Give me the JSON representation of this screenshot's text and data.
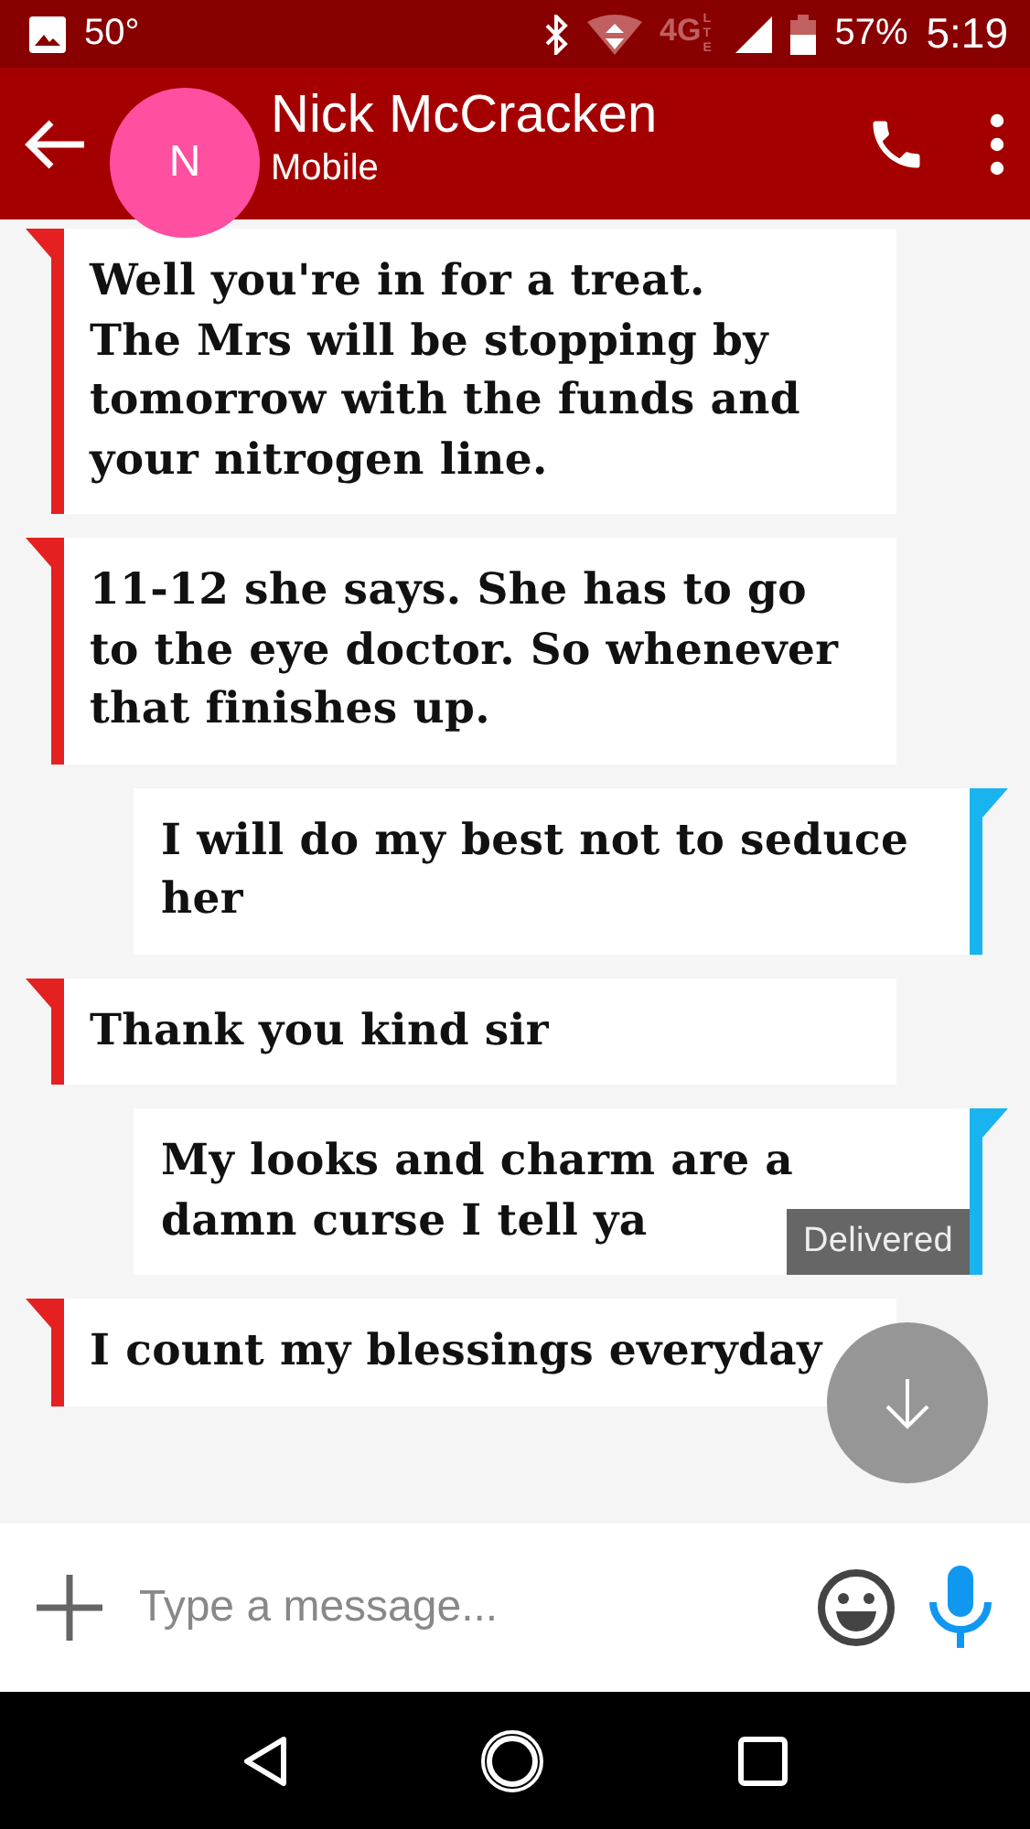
{
  "status_bar": {
    "temperature": "50°",
    "network": "4G",
    "network_sub": "LTE",
    "battery": "57%",
    "time": "5:19"
  },
  "header": {
    "avatar_letter": "N",
    "name": "Nick McCracken",
    "subtitle": "Mobile"
  },
  "messages": [
    {
      "kind": "incoming",
      "text": "Well you're in for a treat.\nThe Mrs will be stopping by tomorrow with the funds and your nitrogen line."
    },
    {
      "kind": "incoming",
      "text": "11-12 she says. She has to go to the eye doctor. So whenever that finishes up."
    },
    {
      "kind": "outgoing",
      "text": "I will do my best not to seduce her"
    },
    {
      "kind": "incoming",
      "text": "Thank you kind sir"
    },
    {
      "kind": "outgoing",
      "text": "My looks and charm are a damn curse I tell ya",
      "status": "Delivered"
    },
    {
      "kind": "incoming",
      "text": "I count my blessings everyday"
    }
  ],
  "composer": {
    "placeholder": "Type a message..."
  }
}
